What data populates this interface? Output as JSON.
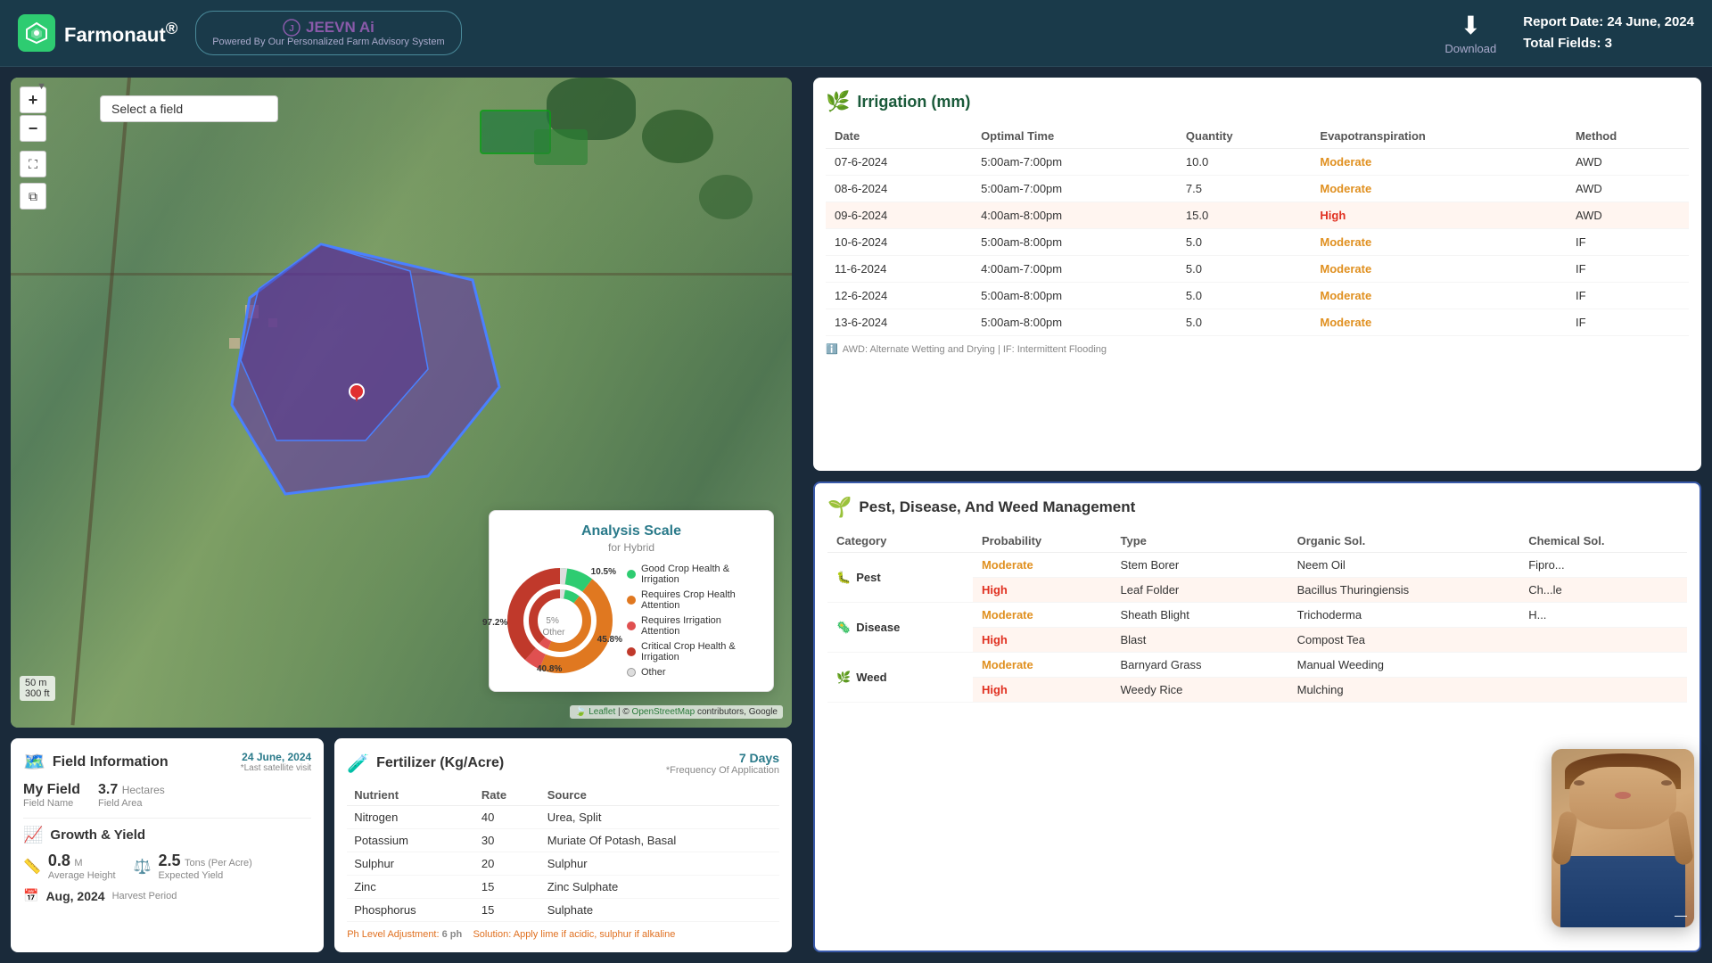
{
  "header": {
    "logo_text": "Farmonaut",
    "logo_reg": "®",
    "jeevn_label": "JEEVN Ai",
    "jeevn_powered": "Powered By",
    "jeevn_sub": "Our Personalized Farm Advisory System",
    "download_label": "Download",
    "report_date_label": "Report Date:",
    "report_date": "24 June, 2024",
    "total_fields_label": "Total Fields:",
    "total_fields": "3"
  },
  "map": {
    "field_selector_placeholder": "Select a field",
    "zoom_in": "+",
    "zoom_out": "−",
    "scale_m": "50 m",
    "scale_ft": "300 ft",
    "attribution_leaflet": "Leaflet",
    "attribution_osm": "OpenStreetMap",
    "attribution_rest": "contributors, Google"
  },
  "analysis_scale": {
    "title": "Analysis Scale",
    "subtitle": "for Hybrid",
    "pct_good": "10.5%",
    "pct_requires_crop": "45.8%",
    "pct_requires_irr": "97.2%",
    "pct_other": "40.8%",
    "pct_5": "5%",
    "other_label": "Other",
    "legend": [
      {
        "color": "#2ecc71",
        "label": "Good Crop Health & Irrigation"
      },
      {
        "color": "#e07820",
        "label": "Requires Crop Health Attention"
      },
      {
        "color": "#e03030",
        "label": "Requires Irrigation Attention"
      },
      {
        "color": "#c0392b",
        "label": "Critical Crop Health & Irrigation"
      },
      {
        "color": "#ffffff",
        "label": "Other",
        "border": "#999"
      }
    ]
  },
  "field_info": {
    "title": "Field Information",
    "date": "24 June, 2024",
    "date_sub": "*Last satellite visit",
    "field_name_label": "Field Name",
    "field_name": "My Field",
    "field_area_label": "Field Area",
    "field_area_value": "3.7",
    "field_area_unit": "Hectares",
    "growth_title": "Growth & Yield",
    "avg_height_value": "0.8",
    "avg_height_unit": "M",
    "avg_height_label": "Average Height",
    "yield_value": "2.5",
    "yield_unit": "Tons",
    "yield_sub": "(Per Acre)",
    "yield_label": "Expected Yield",
    "harvest_value": "Aug, 2024",
    "harvest_label": "Harvest Period"
  },
  "fertilizer": {
    "title": "Fertilizer (Kg/Acre)",
    "frequency": "7 Days",
    "frequency_sub": "*Frequency Of Application",
    "cols": [
      "Nutrient",
      "Rate",
      "Source"
    ],
    "rows": [
      {
        "nutrient": "Nitrogen",
        "rate": "40",
        "source": "Urea, Split"
      },
      {
        "nutrient": "Potassium",
        "rate": "30",
        "source": "Muriate Of Potash, Basal"
      },
      {
        "nutrient": "Sulphur",
        "rate": "20",
        "source": "Sulphur"
      },
      {
        "nutrient": "Zinc",
        "rate": "15",
        "source": "Zinc Sulphate"
      },
      {
        "nutrient": "Phosphorus",
        "rate": "15",
        "source": "Sulphate"
      }
    ],
    "ph_note": "Ph Level Adjustment:",
    "ph_value": "6 ph",
    "solution_note": "Solution:",
    "solution_value": "Apply lime if acidic, sulphur if alkaline"
  },
  "irrigation": {
    "title": "Irrigation (mm)",
    "cols": [
      "Date",
      "Optimal Time",
      "Quantity",
      "Evapotranspiration",
      "Method"
    ],
    "rows": [
      {
        "date": "07-6-2024",
        "time": "5:00am-7:00pm",
        "qty": "10.0",
        "evap": "Moderate",
        "method": "AWD",
        "highlight": false
      },
      {
        "date": "08-6-2024",
        "time": "5:00am-7:00pm",
        "qty": "7.5",
        "evap": "Moderate",
        "method": "AWD",
        "highlight": false
      },
      {
        "date": "09-6-2024",
        "time": "4:00am-8:00pm",
        "qty": "15.0",
        "evap": "High",
        "method": "AWD",
        "highlight": true
      },
      {
        "date": "10-6-2024",
        "time": "5:00am-8:00pm",
        "qty": "5.0",
        "evap": "Moderate",
        "method": "IF",
        "highlight": false
      },
      {
        "date": "11-6-2024",
        "time": "4:00am-7:00pm",
        "qty": "5.0",
        "evap": "Moderate",
        "method": "IF",
        "highlight": false
      },
      {
        "date": "12-6-2024",
        "time": "5:00am-8:00pm",
        "qty": "5.0",
        "evap": "Moderate",
        "method": "IF",
        "highlight": false
      },
      {
        "date": "13-6-2024",
        "time": "5:00am-8:00pm",
        "qty": "5.0",
        "evap": "Moderate",
        "method": "IF",
        "highlight": false
      }
    ],
    "note": "AWD: Alternate Wetting and Drying | IF: Intermittent Flooding"
  },
  "pest": {
    "title": "Pest, Disease, And Weed Management",
    "cols": [
      "Category",
      "Probability",
      "Type",
      "Organic Sol.",
      "Chemical Sol."
    ],
    "sections": [
      {
        "category": "Pest",
        "icon": "🐛",
        "rows": [
          {
            "prob": "Moderate",
            "type": "Stem Borer",
            "organic": "Neem Oil",
            "chemical": "Fipro...",
            "alt": false
          },
          {
            "prob": "High",
            "type": "Leaf Folder",
            "organic": "Bacillus Thuringiensis",
            "chemical": "Ch...le",
            "alt": true
          }
        ]
      },
      {
        "category": "Disease",
        "icon": "🦠",
        "rows": [
          {
            "prob": "Moderate",
            "type": "Sheath Blight",
            "organic": "Trichoderma",
            "chemical": "H...",
            "alt": false
          },
          {
            "prob": "High",
            "type": "Blast",
            "organic": "Compost Tea",
            "chemical": "",
            "alt": true
          }
        ]
      },
      {
        "category": "Weed",
        "icon": "🌿",
        "rows": [
          {
            "prob": "Moderate",
            "type": "Barnyard Grass",
            "organic": "Manual Weeding",
            "chemical": "",
            "alt": false
          },
          {
            "prob": "High",
            "type": "Weedy Rice",
            "organic": "Mulching",
            "chemical": "",
            "alt": true
          }
        ]
      }
    ]
  }
}
